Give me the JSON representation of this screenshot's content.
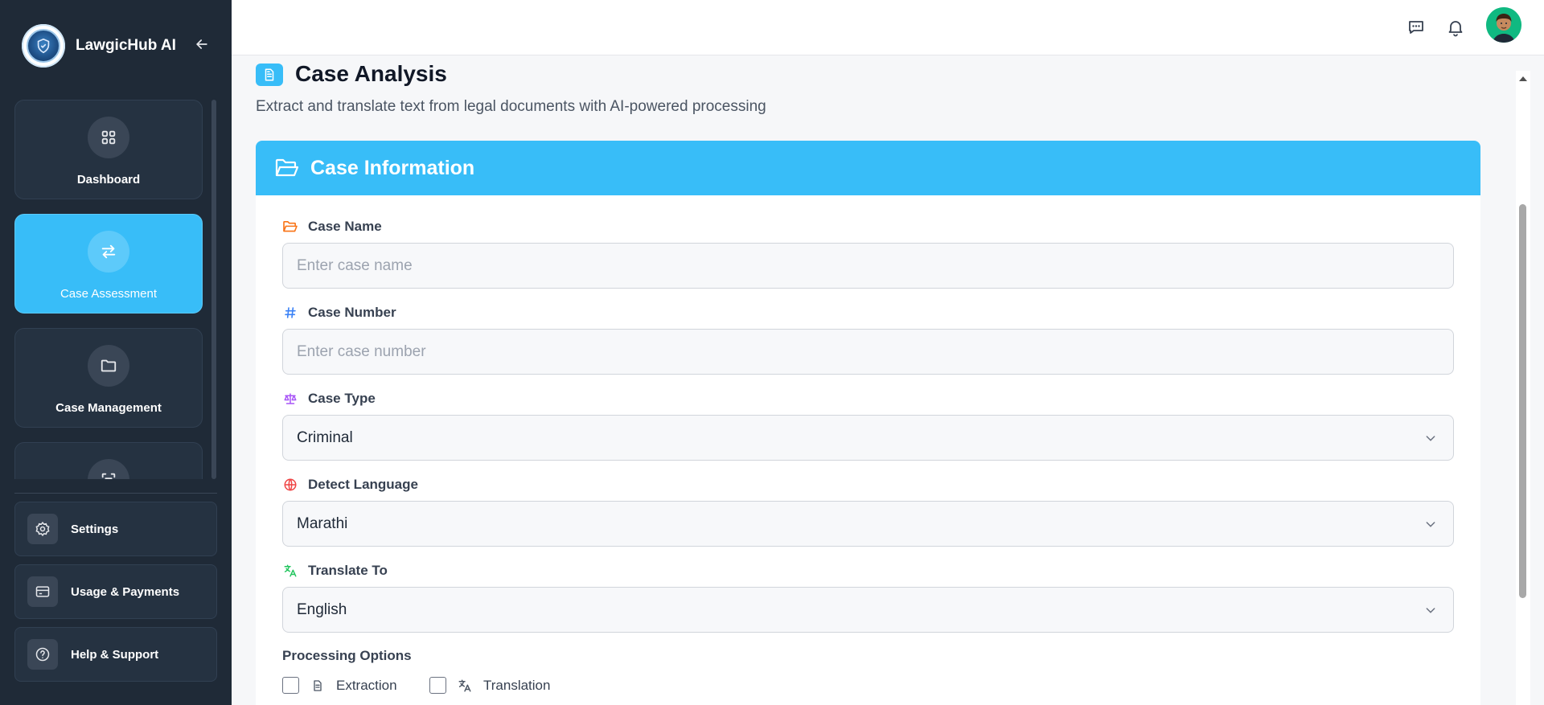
{
  "sidebar": {
    "brand_name": "LawgicHub AI",
    "collapse_icon": "arrow-left-icon",
    "nav": [
      {
        "label": "Dashboard",
        "icon": "grid-icon",
        "active": false
      },
      {
        "label": "Case Assessment",
        "icon": "swap-arrows-icon",
        "active": true
      },
      {
        "label": "Case Management",
        "icon": "folder-icon",
        "active": false
      },
      {
        "label": "",
        "icon": "scan-text-icon",
        "active": false
      }
    ],
    "bottom": [
      {
        "label": "Settings",
        "icon": "gear-icon"
      },
      {
        "label": "Usage & Payments",
        "icon": "credit-card-icon"
      },
      {
        "label": "Help & Support",
        "icon": "help-circle-icon"
      }
    ]
  },
  "topbar": {
    "icons": [
      "chat-icon",
      "bell-icon",
      "avatar"
    ]
  },
  "page": {
    "title": "Case Analysis",
    "subtitle": "Extract and translate text from legal documents with AI-powered processing"
  },
  "card": {
    "header": "Case Information",
    "case_name": {
      "label": "Case Name",
      "placeholder": "Enter case name",
      "value": ""
    },
    "case_number": {
      "label": "Case Number",
      "placeholder": "Enter case number",
      "value": ""
    },
    "case_type": {
      "label": "Case Type",
      "value": "Criminal"
    },
    "detect_language": {
      "label": "Detect Language",
      "value": "Marathi"
    },
    "translate_to": {
      "label": "Translate To",
      "value": "English"
    },
    "processing": {
      "label": "Processing Options",
      "options": [
        {
          "label": "Extraction",
          "checked": false
        },
        {
          "label": "Translation",
          "checked": false
        }
      ]
    }
  },
  "colors": {
    "accent": "#38bdf8",
    "sidebar_bg": "#1f2a37",
    "case_name_icon": "#f97316",
    "case_number_icon": "#3b82f6",
    "case_type_icon": "#a855f7",
    "detect_language_icon": "#ef4444",
    "translate_to_icon": "#22c55e"
  }
}
